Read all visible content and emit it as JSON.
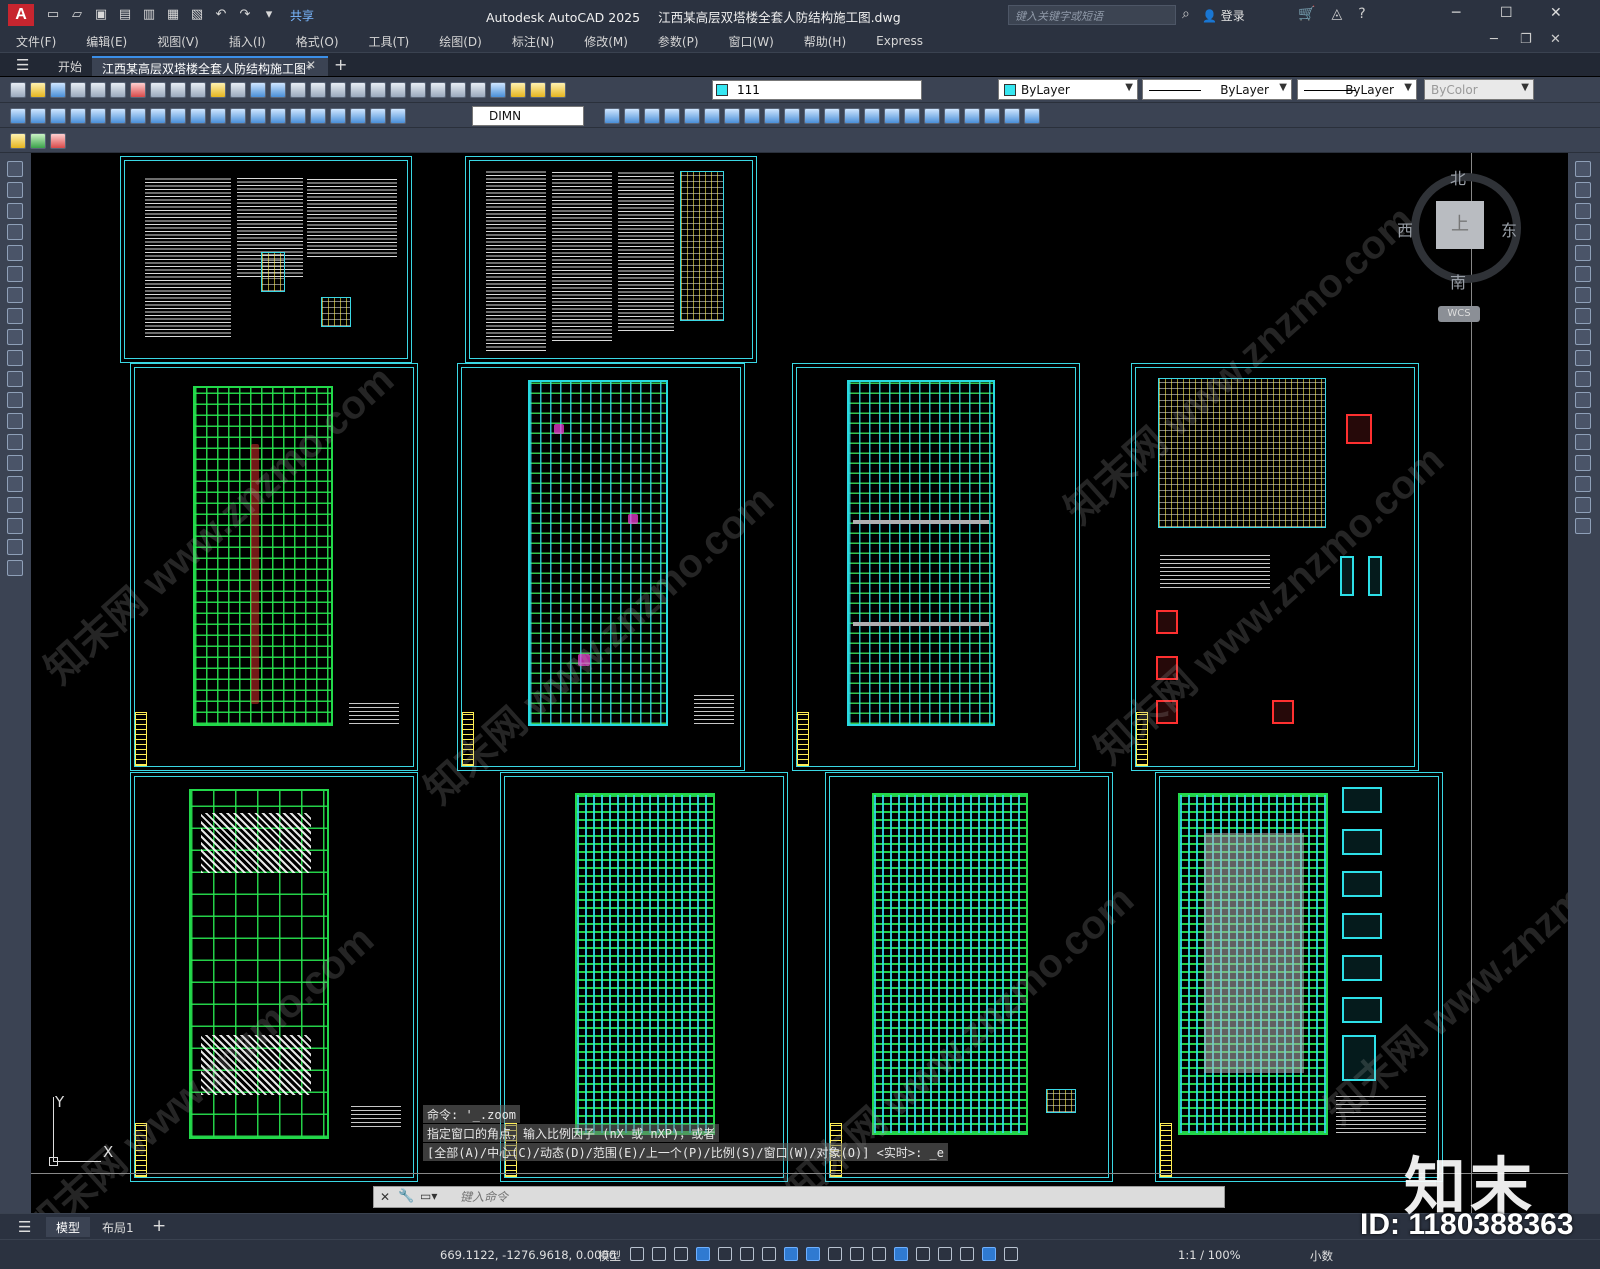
{
  "titlebar": {
    "app_logo": "A",
    "share_label": "共享",
    "app_name": "Autodesk AutoCAD 2025",
    "document": "江西某高层双塔楼全套人防结构施工图.dwg",
    "search_placeholder": "键入关键字或短语",
    "login_label": "登录",
    "minimize": "─",
    "maximize": "☐",
    "close": "✕"
  },
  "menubar": {
    "items": [
      "文件(F)",
      "编辑(E)",
      "视图(V)",
      "插入(I)",
      "格式(O)",
      "工具(T)",
      "绘图(D)",
      "标注(N)",
      "修改(M)",
      "参数(P)",
      "窗口(W)",
      "帮助(H)",
      "Express"
    ]
  },
  "tabs": {
    "start": "开始",
    "active": "江西某高层双塔楼全套人防结构施工图*",
    "close": "✕",
    "add": "+"
  },
  "toolbar": {
    "layer": "111",
    "color": "ByLayer",
    "linetype": "ByLayer",
    "lineweight": "ByLayer",
    "plotstyle": "ByColor",
    "dimstyle": "DIMN",
    "accent_color": "#36e6f0"
  },
  "viewcube": {
    "north": "北",
    "south": "南",
    "east": "东",
    "west": "西",
    "top": "上",
    "wcs": "WCS"
  },
  "ucs": {
    "x": "X",
    "y": "Y"
  },
  "command_history": [
    "命令: '_.zoom",
    "指定窗口的角点，输入比例因子 (nX 或 nXP)，或者",
    "[全部(A)/中心(C)/动态(D)/范围(E)/上一个(P)/比例(S)/窗口(W)/对象(O)] <实时>: _e"
  ],
  "command": {
    "close": "✕",
    "placeholder": "键入命令"
  },
  "layout_tabs": {
    "model": "模型",
    "layout1": "布局1",
    "add": "+"
  },
  "status": {
    "coords": "669.1122, -1276.9618, 0.0000",
    "space": "模型",
    "scale": "1:1 / 100%",
    "units": "小数"
  },
  "overlays": {
    "brand": "知末",
    "image_id": "ID: 1180388363",
    "watermark": "知末网 www.znzmo.com"
  }
}
